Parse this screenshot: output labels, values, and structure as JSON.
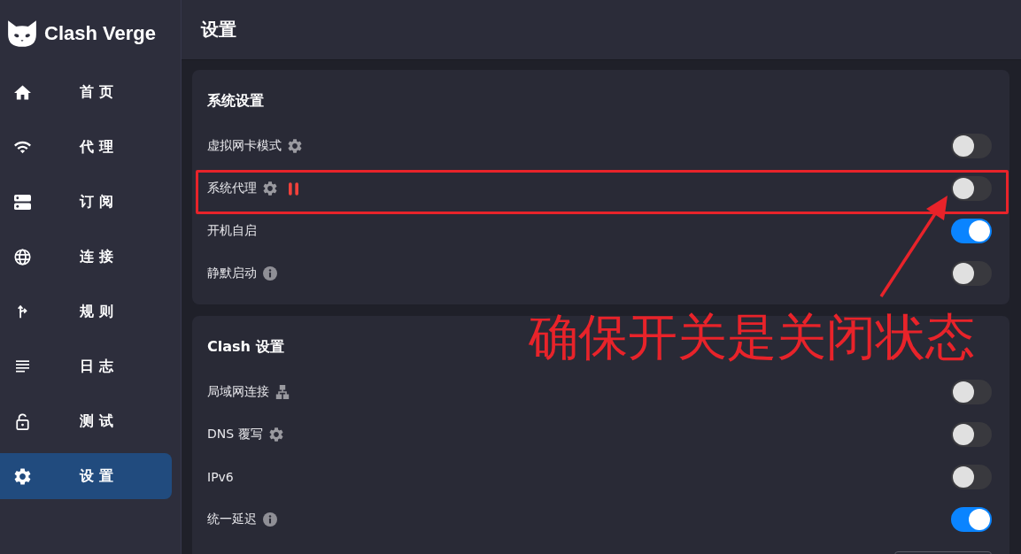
{
  "app": {
    "name": "Clash Verge"
  },
  "sidebar": {
    "items": [
      {
        "label": "首页",
        "selected": false
      },
      {
        "label": "代理",
        "selected": false
      },
      {
        "label": "订阅",
        "selected": false
      },
      {
        "label": "连接",
        "selected": false
      },
      {
        "label": "规则",
        "selected": false
      },
      {
        "label": "日志",
        "selected": false
      },
      {
        "label": "测试",
        "selected": false
      },
      {
        "label": "设置",
        "selected": true
      }
    ]
  },
  "header": {
    "title": "设置"
  },
  "sections": [
    {
      "title": "系统设置",
      "rows": [
        {
          "kind": "switch",
          "label": "虚拟网卡模式",
          "extra": {
            "kind": "settings"
          },
          "on": false
        },
        {
          "kind": "switch",
          "label": "系统代理",
          "extra": {
            "kind": "settings"
          },
          "running": false,
          "on": false
        },
        {
          "kind": "switch",
          "label": "开机自启",
          "on": true
        },
        {
          "kind": "switch",
          "label": "静默启动",
          "extra": {
            "kind": "help"
          },
          "on": false
        }
      ]
    },
    {
      "title": "Clash 设置",
      "rows": [
        {
          "kind": "switch",
          "label": "局域网连接",
          "extra": {
            "kind": "network"
          },
          "on": false
        },
        {
          "kind": "switch",
          "label": "DNS 覆写",
          "extra": {
            "kind": "settings"
          },
          "on": false
        },
        {
          "kind": "switch",
          "label": "IPv6",
          "on": false
        },
        {
          "kind": "switch",
          "label": "统一延迟",
          "extra": {
            "kind": "help"
          },
          "on": true
        },
        {
          "kind": "select"
        }
      ]
    }
  ],
  "annotation": {
    "text": "确保开关是关闭状态"
  }
}
